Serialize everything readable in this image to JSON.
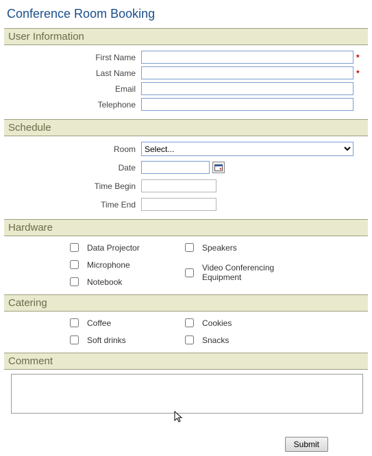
{
  "title": "Conference Room Booking",
  "sections": {
    "user_info": {
      "header": "User Information",
      "first_name_label": "First Name",
      "first_name_value": "",
      "last_name_label": "Last Name",
      "last_name_value": "",
      "email_label": "Email",
      "email_value": "",
      "telephone_label": "Telephone",
      "telephone_value": ""
    },
    "schedule": {
      "header": "Schedule",
      "room_label": "Room",
      "room_selected": "Select...",
      "date_label": "Date",
      "date_value": "",
      "time_begin_label": "Time Begin",
      "time_begin_value": "",
      "time_end_label": "Time End",
      "time_end_value": ""
    },
    "hardware": {
      "header": "Hardware",
      "left": [
        {
          "label": "Data Projector",
          "checked": false
        },
        {
          "label": "Microphone",
          "checked": false
        },
        {
          "label": "Notebook",
          "checked": false
        }
      ],
      "right": [
        {
          "label": "Speakers",
          "checked": false
        },
        {
          "label": "Video Conferencing Equipment",
          "checked": false
        }
      ]
    },
    "catering": {
      "header": "Catering",
      "left": [
        {
          "label": "Coffee",
          "checked": false
        },
        {
          "label": "Soft drinks",
          "checked": false
        }
      ],
      "right": [
        {
          "label": "Cookies",
          "checked": false
        },
        {
          "label": "Snacks",
          "checked": false
        }
      ]
    },
    "comment": {
      "header": "Comment",
      "value": ""
    }
  },
  "actions": {
    "submit_label": "Submit"
  }
}
